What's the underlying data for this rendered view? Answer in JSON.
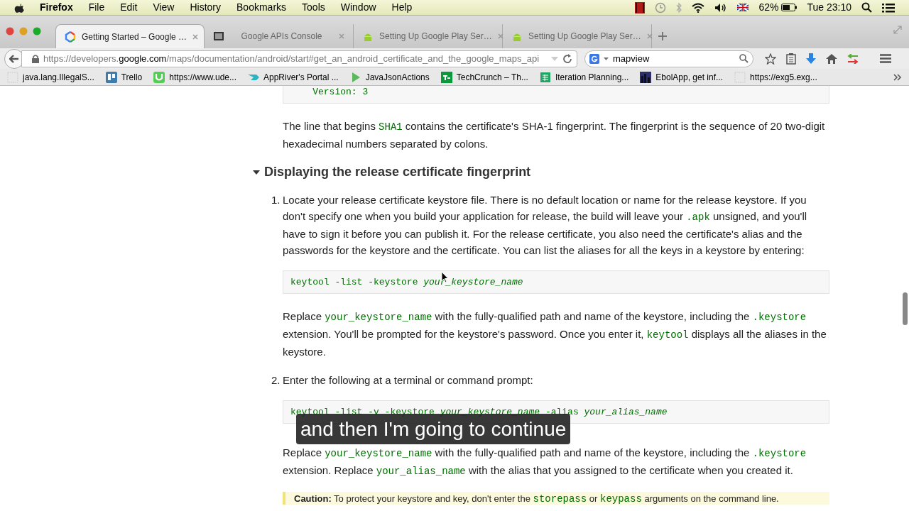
{
  "menu_bar": {
    "app": "Firefox",
    "items": [
      "File",
      "Edit",
      "View",
      "History",
      "Bookmarks",
      "Tools",
      "Window",
      "Help"
    ],
    "battery": "62%",
    "clock": "Tue 23:10"
  },
  "tabs": [
    {
      "label": "Getting Started – Google …",
      "selected": true,
      "kind": "google"
    },
    {
      "label": "Google APIs Console",
      "selected": false,
      "kind": "console"
    },
    {
      "label": "Setting Up Google Play Ser…",
      "selected": false,
      "kind": "android"
    },
    {
      "label": "Setting Up Google Play Ser…",
      "selected": false,
      "kind": "android"
    }
  ],
  "address": {
    "prefix": "https://developers.",
    "domain": "google.com",
    "path": "/maps/documentation/android/start#get_an_android_certificate_and_the_google_maps_api"
  },
  "search": {
    "value": "mapview"
  },
  "bookmarks": [
    {
      "label": "java.lang.IllegalS...",
      "kind": "blank"
    },
    {
      "label": "Trello",
      "kind": "trello"
    },
    {
      "label": "https://www.ude...",
      "kind": "udemy"
    },
    {
      "label": "AppRiver's Portal ...",
      "kind": "wing"
    },
    {
      "label": "JavaJsonActions",
      "kind": "play"
    },
    {
      "label": "TechCrunch – Th...",
      "kind": "tc"
    },
    {
      "label": "Iteration Planning...",
      "kind": "sheet"
    },
    {
      "label": "EbolApp, get inf...",
      "kind": "city"
    },
    {
      "label": "https://exg5.exg...",
      "kind": "blank"
    }
  ],
  "content": [
    {
      "kind": "code",
      "text": "    Version: 3"
    },
    {
      "kind": "para",
      "segments": [
        {
          "t": "The line that begins ",
          "kind": "plain"
        },
        {
          "t": "SHA1",
          "kind": "code"
        },
        {
          "t": " contains the certificate's SHA-1 fingerprint. The fingerprint is the sequence of 20 two-digit hexadecimal numbers separated by colons.",
          "kind": "plain"
        }
      ]
    },
    {
      "kind": "heading",
      "text": "Displaying the release certificate fingerprint",
      "expanded": true
    },
    {
      "kind": "step",
      "number": "1.",
      "blocks": [
        {
          "kind": "para",
          "segments": [
            {
              "t": "Locate your release certificate keystore file. There is no default location or name for the release keystore. If you don't specify one when you build your application for release, the build will leave your ",
              "kind": "plain"
            },
            {
              "t": ".apk",
              "kind": "code"
            },
            {
              "t": " unsigned, and you'll have to sign it before you can publish it. For the release certificate, you also need the certificate's alias and the passwords for the keystore and the certificate. You can list the aliases for all the keys in a keystore by entering:",
              "kind": "plain"
            }
          ]
        },
        {
          "kind": "code",
          "text": "keytool -list -keystore *your_keystore_name*"
        },
        {
          "kind": "para",
          "segments": [
            {
              "t": "Replace ",
              "kind": "plain"
            },
            {
              "t": "your_keystore_name",
              "kind": "code"
            },
            {
              "t": " with the fully-qualified path and name of the keystore, including the ",
              "kind": "plain"
            },
            {
              "t": ".keystore",
              "kind": "code"
            },
            {
              "t": " extension. You'll be prompted for the keystore's password. Once you enter it, ",
              "kind": "plain"
            },
            {
              "t": "keytool",
              "kind": "code"
            },
            {
              "t": " displays all the aliases in the keystore.",
              "kind": "plain"
            }
          ]
        }
      ]
    },
    {
      "kind": "step",
      "number": "2.",
      "blocks": [
        {
          "kind": "para",
          "segments": [
            {
              "t": "Enter the following at a terminal or command prompt:",
              "kind": "plain"
            }
          ]
        },
        {
          "kind": "code",
          "text": "keytool -list -v -keystore *your_keystore_name* -alias *your_alias_name*"
        },
        {
          "kind": "para",
          "segments": [
            {
              "t": "Replace ",
              "kind": "plain"
            },
            {
              "t": "your_keystore_name",
              "kind": "code"
            },
            {
              "t": " with the fully-qualified path and name of the keystore, including the ",
              "kind": "plain"
            },
            {
              "t": ".keystore",
              "kind": "code"
            },
            {
              "t": " extension. Replace ",
              "kind": "plain"
            },
            {
              "t": "your_alias_name",
              "kind": "code"
            },
            {
              "t": " with the alias that you assigned to the certificate when you created it.",
              "kind": "plain"
            }
          ]
        },
        {
          "kind": "caution",
          "segments": [
            {
              "t": "Caution:",
              "kind": "bold"
            },
            {
              "t": " To protect your keystore and key, don't enter the ",
              "kind": "plain"
            },
            {
              "t": "storepass",
              "kind": "code"
            },
            {
              "t": " or ",
              "kind": "plain"
            },
            {
              "t": "keypass",
              "kind": "code"
            },
            {
              "t": " arguments on the command line.",
              "kind": "plain"
            }
          ]
        }
      ]
    }
  ],
  "subtitle": "and then I'm going to continue"
}
